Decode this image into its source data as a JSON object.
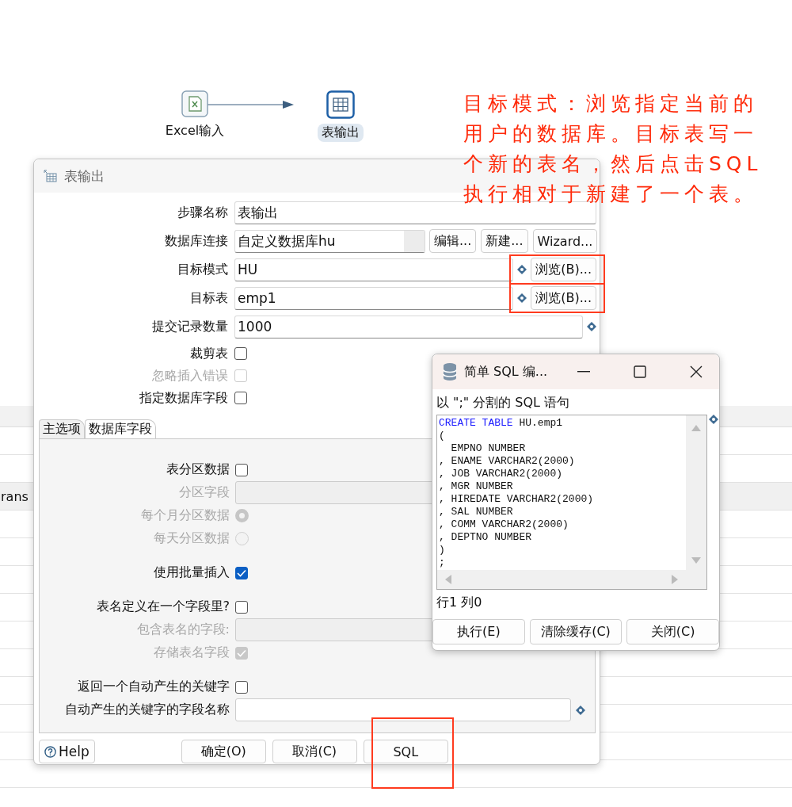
{
  "canvas": {
    "steps": [
      {
        "label": "Excel输入",
        "kind": "excel",
        "selected": false
      },
      {
        "label": "表输出",
        "kind": "table",
        "selected": true
      }
    ]
  },
  "annotation": {
    "text": "目标模式：浏览指定当前的用户的数据库。目标表写一个新的表名，然后点击SQL执行相对于新建了一个表。"
  },
  "background_table": {
    "cell": "rans"
  },
  "dialog": {
    "title": "表输出",
    "fields": [
      {
        "label": "步骤名称",
        "value": "表输出",
        "variable": false,
        "highlighted": false
      },
      {
        "label": "数据库连接",
        "value": "自定义数据库hu",
        "kind": "connection",
        "variable": false,
        "highlighted": false,
        "buttons": [
          "编辑...",
          "新建...",
          "Wizard..."
        ]
      },
      {
        "label": "目标模式",
        "value": "HU",
        "variable": true,
        "highlighted": true,
        "buttons": [
          "浏览(B)..."
        ]
      },
      {
        "label": "目标表",
        "value": "emp1",
        "variable": true,
        "highlighted": true,
        "buttons": [
          "浏览(B)..."
        ]
      },
      {
        "label": "提交记录数量",
        "value": "1000",
        "variable": true,
        "highlighted": false
      }
    ],
    "checks": [
      {
        "label": "裁剪表",
        "checked": false,
        "disabled": false
      },
      {
        "label": "忽略插入错误",
        "checked": false,
        "disabled": true
      },
      {
        "label": "指定数据库字段",
        "checked": false,
        "disabled": false
      }
    ],
    "tabs": [
      {
        "label": "主选项",
        "selected": true
      },
      {
        "label": "数据库字段",
        "selected": false
      }
    ],
    "groups": [
      [
        {
          "kind": "checkbox",
          "label": "表分区数据",
          "checked": false,
          "disabled": false
        },
        {
          "kind": "field",
          "label": "分区字段",
          "disabled": true,
          "variable": false
        },
        {
          "kind": "radio",
          "label": "每个月分区数据",
          "selected": true,
          "disabled": true
        },
        {
          "kind": "radio",
          "label": "每天分区数据",
          "selected": false,
          "disabled": true
        }
      ],
      [
        {
          "kind": "checkbox",
          "label": "使用批量插入",
          "checked": true,
          "disabled": false
        }
      ],
      [
        {
          "kind": "checkbox",
          "label": "表名定义在一个字段里?",
          "checked": false,
          "disabled": false
        },
        {
          "kind": "field",
          "label": "包含表名的字段:",
          "disabled": true,
          "variable": false
        },
        {
          "kind": "checkbox",
          "label": "存储表名字段",
          "checked": true,
          "disabled": true
        }
      ],
      [
        {
          "kind": "checkbox",
          "label": "返回一个自动产生的关键字",
          "checked": false,
          "disabled": false
        },
        {
          "kind": "field",
          "label": "自动产生的关键字的字段名称",
          "disabled": false,
          "variable": true
        }
      ]
    ],
    "help": "Help",
    "buttons": [
      {
        "label": "确定(O)",
        "highlighted": false
      },
      {
        "label": "取消(C)",
        "highlighted": false
      },
      {
        "label": "SQL",
        "highlighted": true
      }
    ]
  },
  "sql_dialog": {
    "title": "简单 SQL 编...",
    "caption": "以 \";\" 分割的 SQL 语句",
    "lines": [
      {
        "keyword": "CREATE TABLE",
        "rest": " HU.emp1"
      },
      {
        "rest": "("
      },
      {
        "rest": "  EMPNO NUMBER"
      },
      {
        "rest": ", ENAME VARCHAR2(2000)"
      },
      {
        "rest": ", JOB VARCHAR2(2000)"
      },
      {
        "rest": ", MGR NUMBER"
      },
      {
        "rest": ", HIREDATE VARCHAR2(2000)"
      },
      {
        "rest": ", SAL NUMBER"
      },
      {
        "rest": ", COMM VARCHAR2(2000)"
      },
      {
        "rest": ", DEPTNO NUMBER"
      },
      {
        "rest": ")"
      },
      {
        "rest": ";"
      }
    ],
    "variable": true,
    "status": "行1 列0",
    "buttons": [
      "执行(E)",
      "清除缓存(C)",
      "关闭(C)"
    ]
  }
}
